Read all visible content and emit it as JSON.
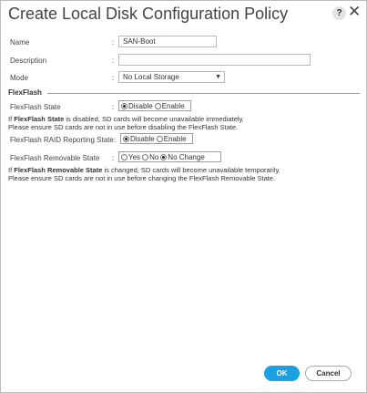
{
  "dialog": {
    "title": "Create Local Disk Configuration Policy",
    "help_label": "?",
    "close_label": "✕"
  },
  "form": {
    "name": {
      "label": "Name",
      "value": "SAN-Boot"
    },
    "description": {
      "label": "Description",
      "value": ""
    },
    "mode": {
      "label": "Mode",
      "value": "No Local Storage"
    },
    "colon": ":"
  },
  "flexflash": {
    "section_title": "FlexFlash",
    "state": {
      "label": "FlexFlash State",
      "options": [
        "Disable",
        "Enable"
      ],
      "selected": "Disable"
    },
    "state_note": {
      "line1_prefix": "If ",
      "line1_bold": "FlexFlash State",
      "line1_suffix": " is disabled, SD cards will become unavailable immediately.",
      "line2": "Please ensure SD cards are not in use before disabling the FlexFlash State."
    },
    "raid": {
      "label": "FlexFlash RAID Reporting State",
      "options": [
        "Disable",
        "Enable"
      ],
      "selected": "Disable"
    },
    "removable": {
      "label": "FlexFlash Removable State",
      "options": [
        "Yes",
        "No",
        "No Change"
      ],
      "selected": "No Change"
    },
    "removable_note": {
      "line1_prefix": "If ",
      "line1_bold": "FlexFlash Removable State",
      "line1_suffix": " is changed, SD cards will become unavailable temporarily.",
      "line2": "Please ensure SD cards are not in use before changing the FlexFlash Removable State."
    }
  },
  "footer": {
    "ok_label": "OK",
    "cancel_label": "Cancel"
  },
  "colors": {
    "accent": "#1ba0e1"
  }
}
